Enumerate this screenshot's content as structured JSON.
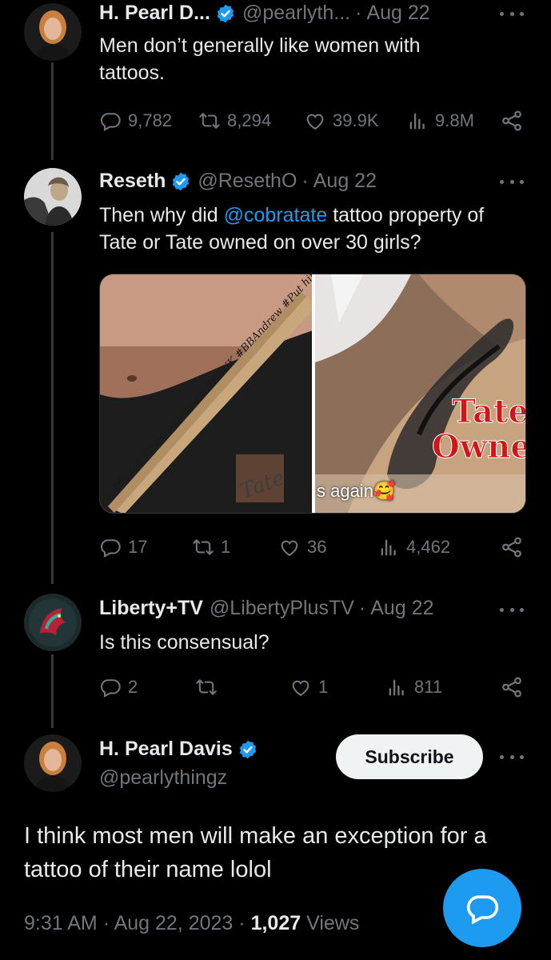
{
  "tweets": [
    {
      "name": "H. Pearl D...",
      "handle": "@pearlyth...",
      "date": "Aug 22",
      "text": "Men don’t generally like women with tattoos.",
      "replies": "9,782",
      "retweets": "8,294",
      "likes": "39.9K",
      "views": "9.8M"
    },
    {
      "name": "Reseth",
      "handle": "@ResethO",
      "date": "Aug 22",
      "text_before": "Then why did ",
      "mention": "@cobratate",
      "text_after": " tattoo property of Tate or Tate owned on over 30 girls?",
      "media_left_caption": "I ♡ When Andrew spanks me #BBUK #BBAndrew #Put him back",
      "media_left_signature": "Tate",
      "media_right_overlay_1": "Tate",
      "media_right_overlay_2": "Owne",
      "media_right_caption": "s again🥰",
      "replies": "17",
      "retweets": "1",
      "likes": "36",
      "views": "4,462"
    },
    {
      "name": "Liberty+TV",
      "handle": "@LibertyPlusTV",
      "date": "Aug 22",
      "text": "Is this consensual?",
      "replies": "2",
      "retweets": "",
      "likes": "1",
      "views": "811"
    }
  ],
  "main_tweet": {
    "name": "H. Pearl Davis",
    "handle": "@pearlythingz",
    "subscribe_label": "Subscribe",
    "text": "I think most men will make an exception for a tattoo of their name lolol",
    "time": "9:31 AM",
    "date": "Aug 22, 2023",
    "views_count": "1,027",
    "views_label": "Views"
  },
  "icons": [
    "reply-icon",
    "retweet-icon",
    "like-icon",
    "views-icon",
    "share-icon",
    "more-icon",
    "verified-badge-icon",
    "compose-reply-icon"
  ],
  "colors": {
    "background": "#000000",
    "text": "#e7e9ea",
    "muted": "#71767b",
    "accent": "#1d9bf0",
    "subscribe_bg": "#eff3f4"
  }
}
